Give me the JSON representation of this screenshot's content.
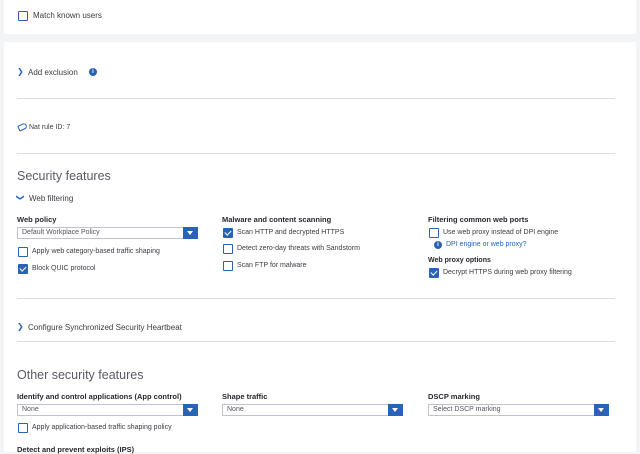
{
  "exclusions": {
    "match_known_users_label": "Match known users",
    "add_exclusion_label": "Add exclusion"
  },
  "nat_rule": {
    "label": "Nat rule ID: 7"
  },
  "security_features": {
    "title": "Security features",
    "web_filtering_label": "Web filtering",
    "web_policy": {
      "heading": "Web policy",
      "selected": "Default Workplace Policy",
      "apply_shaping_label": "Apply web category-based traffic shaping",
      "block_quic_label": "Block QUIC protocol"
    },
    "malware": {
      "heading": "Malware and content scanning",
      "scan_http_label": "Scan HTTP and decrypted HTTPS",
      "zero_day_label": "Detect zero-day threats with Sandstorm",
      "scan_ftp_label": "Scan FTP for malware"
    },
    "filtering_ports": {
      "heading": "Filtering common web ports",
      "use_proxy_label": "Use web proxy instead of DPI engine",
      "dpi_link": "DPI engine or web proxy?"
    },
    "web_proxy": {
      "heading": "Web proxy options",
      "decrypt_label": "Decrypt HTTPS during web proxy filtering"
    },
    "sync_heartbeat_label": "Configure Synchronized Security Heartbeat"
  },
  "other_security": {
    "title": "Other security features",
    "app_control": {
      "heading": "Identify and control applications (App control)",
      "selected": "None",
      "apply_shaping_label": "Apply application-based traffic shaping policy"
    },
    "shape_traffic": {
      "heading": "Shape traffic",
      "selected": "None"
    },
    "dscp": {
      "heading": "DSCP marking",
      "selected": "Select DSCP marking"
    },
    "ips_heading": "Detect and prevent exploits (IPS)"
  }
}
